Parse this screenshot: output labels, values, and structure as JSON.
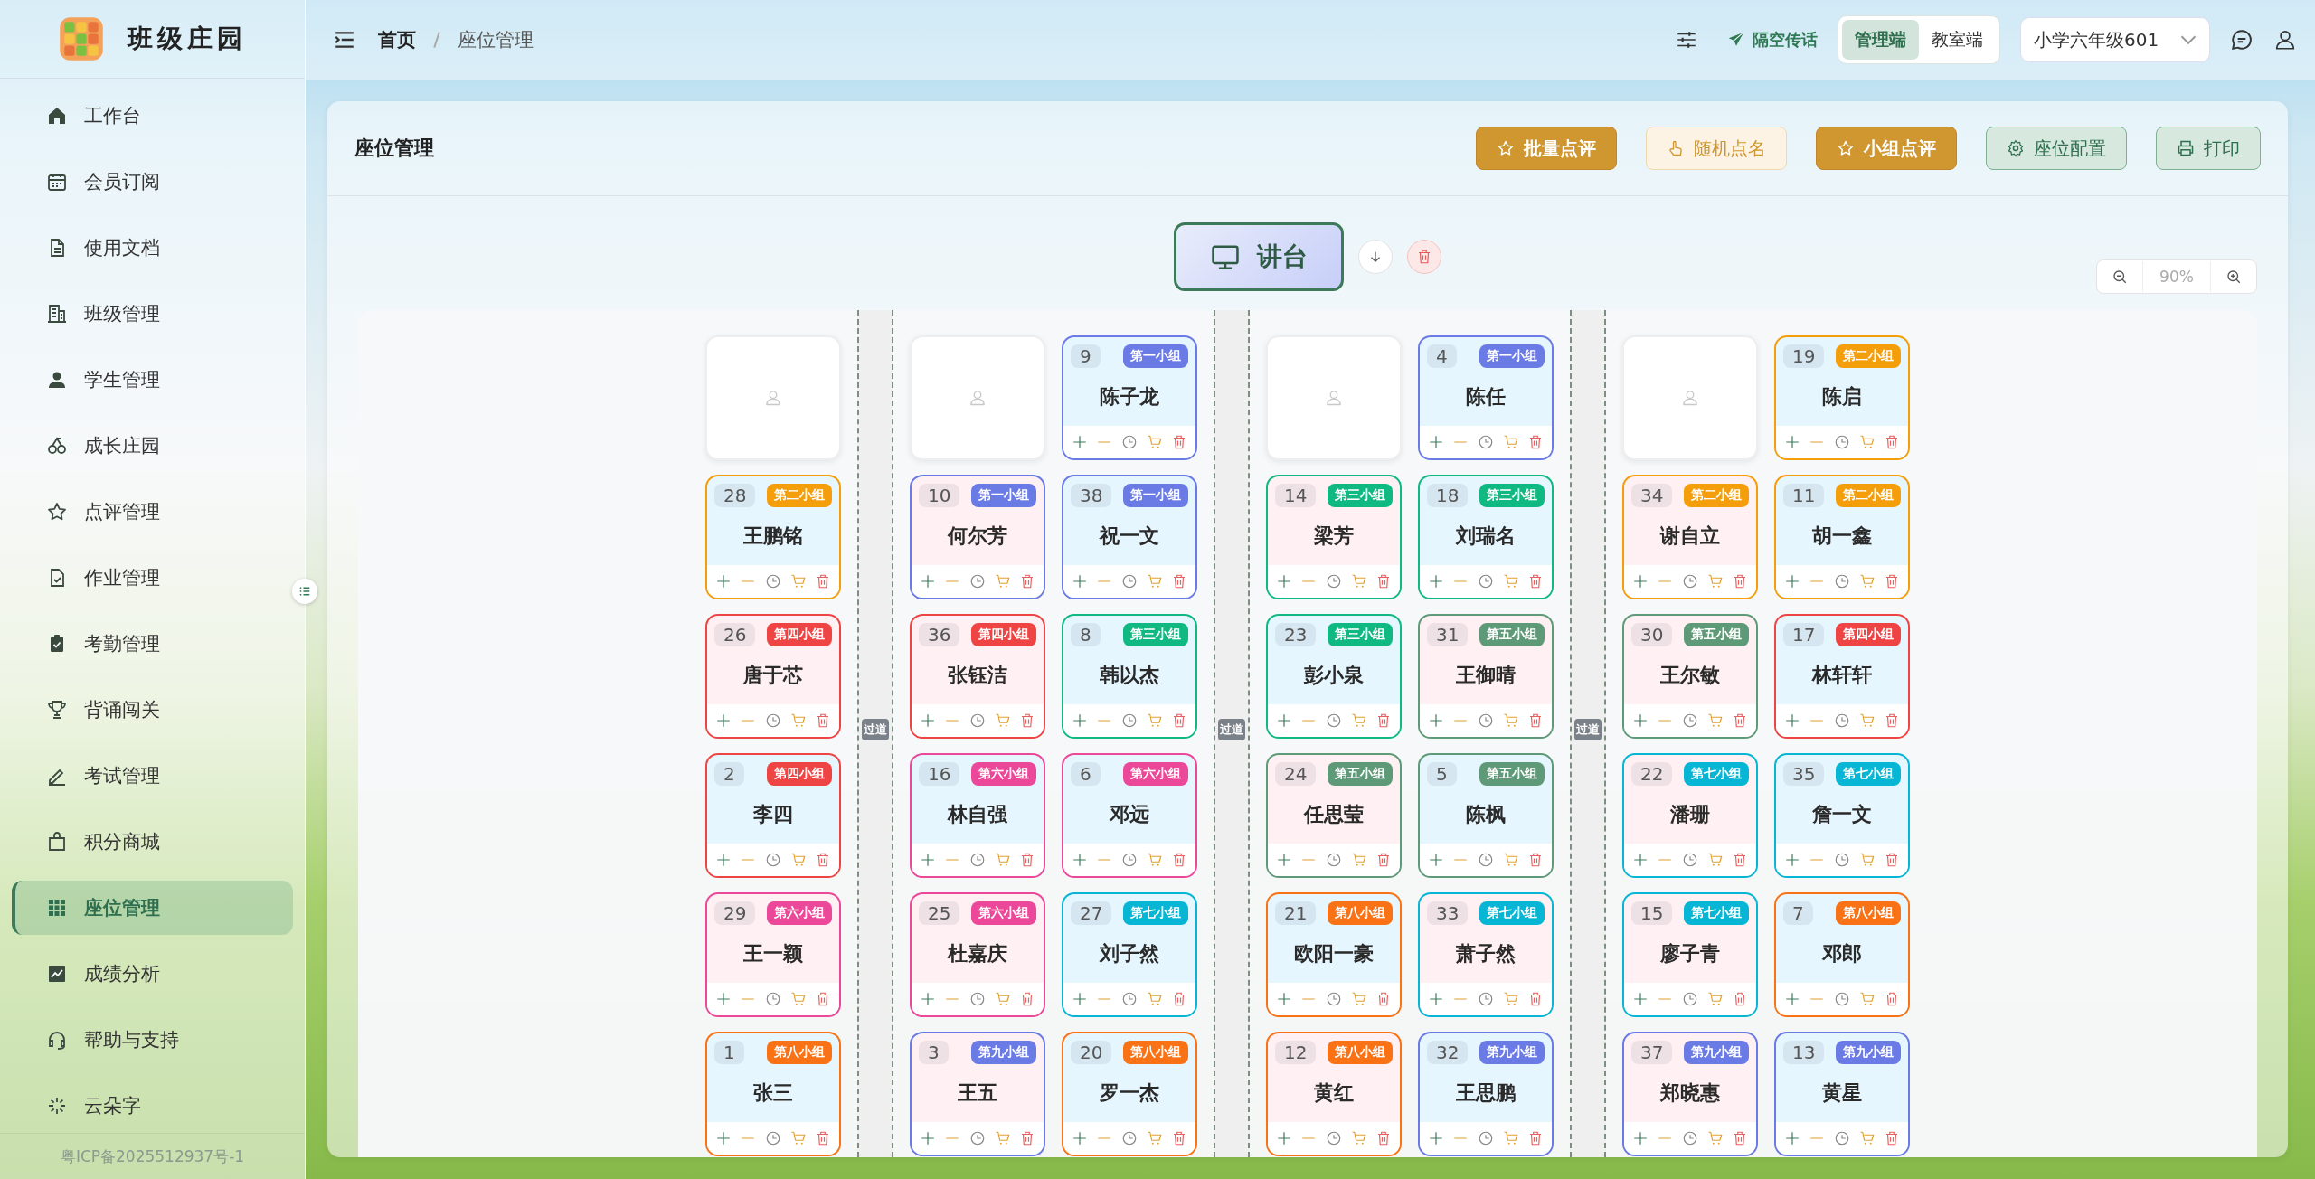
{
  "sidebar": {
    "title": "班级庄园",
    "items": [
      {
        "label": "工作台",
        "selected": false
      },
      {
        "label": "会员订阅",
        "selected": false
      },
      {
        "label": "使用文档",
        "selected": false
      },
      {
        "label": "班级管理",
        "selected": false
      },
      {
        "label": "学生管理",
        "selected": false
      },
      {
        "label": "成长庄园",
        "selected": false
      },
      {
        "label": "点评管理",
        "selected": false
      },
      {
        "label": "作业管理",
        "selected": false
      },
      {
        "label": "考勤管理",
        "selected": false
      },
      {
        "label": "背诵闯关",
        "selected": false
      },
      {
        "label": "考试管理",
        "selected": false
      },
      {
        "label": "积分商城",
        "selected": false
      },
      {
        "label": "座位管理",
        "selected": true
      },
      {
        "label": "成绩分析",
        "selected": false
      },
      {
        "label": "帮助与支持",
        "selected": false
      },
      {
        "label": "云朵字",
        "selected": false
      }
    ],
    "footer": "粤ICP备2025512937号-1"
  },
  "header": {
    "breadcrumb": [
      "首页",
      "座位管理"
    ],
    "broadcast": "隔空传话",
    "modes": [
      {
        "label": "管理端",
        "selected": true
      },
      {
        "label": "教室端",
        "selected": false
      }
    ],
    "class_select": {
      "value": "小学六年级601"
    }
  },
  "panel": {
    "title": "座位管理",
    "actions": [
      {
        "label": "批量点评",
        "kind": "primary"
      },
      {
        "label": "随机点名",
        "kind": "soft"
      },
      {
        "label": "小组点评",
        "kind": "primary"
      },
      {
        "label": "座位配置",
        "kind": "secondary"
      },
      {
        "label": "打印",
        "kind": "secondary"
      }
    ],
    "podium": {
      "label": "讲台"
    },
    "zoom": {
      "value": "90%"
    },
    "layout": [
      {
        "kind": "column",
        "seats": [
          {
            "kind": "empty"
          },
          {
            "kind": "student",
            "number": "28",
            "group": "第二小组",
            "name": "王鹏铭",
            "color": "#f59e0b",
            "warm": false
          },
          {
            "kind": "student",
            "number": "26",
            "group": "第四小组",
            "name": "唐于芯",
            "color": "#ef4444",
            "warm": true
          },
          {
            "kind": "student",
            "number": "2",
            "group": "第四小组",
            "name": "李四",
            "color": "#ef4444",
            "warm": false
          },
          {
            "kind": "student",
            "number": "29",
            "group": "第六小组",
            "name": "王一颖",
            "color": "#ec4899",
            "warm": true
          },
          {
            "kind": "student",
            "number": "1",
            "group": "第八小组",
            "name": "张三",
            "color": "#f97316",
            "warm": false
          }
        ]
      },
      {
        "kind": "aisle",
        "label": "过道"
      },
      {
        "kind": "column",
        "seats": [
          {
            "kind": "empty"
          },
          {
            "kind": "student",
            "number": "10",
            "group": "第一小组",
            "name": "何尔芳",
            "color": "#6b7be6",
            "warm": true
          },
          {
            "kind": "student",
            "number": "36",
            "group": "第四小组",
            "name": "张钰洁",
            "color": "#ef4444",
            "warm": true
          },
          {
            "kind": "student",
            "number": "16",
            "group": "第六小组",
            "name": "林自强",
            "color": "#ec4899",
            "warm": false
          },
          {
            "kind": "student",
            "number": "25",
            "group": "第六小组",
            "name": "杜嘉庆",
            "color": "#ec4899",
            "warm": true
          },
          {
            "kind": "student",
            "number": "3",
            "group": "第九小组",
            "name": "王五",
            "color": "#6b7be6",
            "warm": true
          }
        ]
      },
      {
        "kind": "column",
        "seats": [
          {
            "kind": "student",
            "number": "9",
            "group": "第一小组",
            "name": "陈子龙",
            "color": "#6b7be6",
            "warm": false
          },
          {
            "kind": "student",
            "number": "38",
            "group": "第一小组",
            "name": "祝一文",
            "color": "#6b7be6",
            "warm": false
          },
          {
            "kind": "student",
            "number": "8",
            "group": "第三小组",
            "name": "韩以杰",
            "color": "#10b981",
            "warm": false
          },
          {
            "kind": "student",
            "number": "6",
            "group": "第六小组",
            "name": "邓远",
            "color": "#ec4899",
            "warm": false
          },
          {
            "kind": "student",
            "number": "27",
            "group": "第七小组",
            "name": "刘子然",
            "color": "#06b6d4",
            "warm": false
          },
          {
            "kind": "student",
            "number": "20",
            "group": "第八小组",
            "name": "罗一杰",
            "color": "#f97316",
            "warm": false
          }
        ]
      },
      {
        "kind": "aisle",
        "label": "过道"
      },
      {
        "kind": "column",
        "seats": [
          {
            "kind": "empty"
          },
          {
            "kind": "student",
            "number": "14",
            "group": "第三小组",
            "name": "梁芳",
            "color": "#10b981",
            "warm": true
          },
          {
            "kind": "student",
            "number": "23",
            "group": "第三小组",
            "name": "彭小泉",
            "color": "#10b981",
            "warm": false
          },
          {
            "kind": "student",
            "number": "24",
            "group": "第五小组",
            "name": "任思莹",
            "color": "#5f9a78",
            "warm": true
          },
          {
            "kind": "student",
            "number": "21",
            "group": "第八小组",
            "name": "欧阳一豪",
            "color": "#f97316",
            "warm": false
          },
          {
            "kind": "student",
            "number": "12",
            "group": "第八小组",
            "name": "黄红",
            "color": "#f97316",
            "warm": true
          }
        ]
      },
      {
        "kind": "column",
        "seats": [
          {
            "kind": "student",
            "number": "4",
            "group": "第一小组",
            "name": "陈任",
            "color": "#6b7be6",
            "warm": false
          },
          {
            "kind": "student",
            "number": "18",
            "group": "第三小组",
            "name": "刘瑞名",
            "color": "#10b981",
            "warm": false
          },
          {
            "kind": "student",
            "number": "31",
            "group": "第五小组",
            "name": "王御晴",
            "color": "#5f9a78",
            "warm": true
          },
          {
            "kind": "student",
            "number": "5",
            "group": "第五小组",
            "name": "陈枫",
            "color": "#5f9a78",
            "warm": false
          },
          {
            "kind": "student",
            "number": "33",
            "group": "第七小组",
            "name": "萧子然",
            "color": "#06b6d4",
            "warm": true
          },
          {
            "kind": "student",
            "number": "32",
            "group": "第九小组",
            "name": "王思鹏",
            "color": "#6b7be6",
            "warm": false
          }
        ]
      },
      {
        "kind": "aisle",
        "label": "过道"
      },
      {
        "kind": "column",
        "seats": [
          {
            "kind": "empty"
          },
          {
            "kind": "student",
            "number": "34",
            "group": "第二小组",
            "name": "谢自立",
            "color": "#f59e0b",
            "warm": true
          },
          {
            "kind": "student",
            "number": "30",
            "group": "第五小组",
            "name": "王尔敏",
            "color": "#5f9a78",
            "warm": true
          },
          {
            "kind": "student",
            "number": "22",
            "group": "第七小组",
            "name": "潘珊",
            "color": "#06b6d4",
            "warm": true
          },
          {
            "kind": "student",
            "number": "15",
            "group": "第七小组",
            "name": "廖子青",
            "color": "#06b6d4",
            "warm": true
          },
          {
            "kind": "student",
            "number": "37",
            "group": "第九小组",
            "name": "郑晓惠",
            "color": "#6b7be6",
            "warm": true
          }
        ]
      },
      {
        "kind": "column",
        "seats": [
          {
            "kind": "student",
            "number": "19",
            "group": "第二小组",
            "name": "陈启",
            "color": "#f59e0b",
            "warm": false
          },
          {
            "kind": "student",
            "number": "11",
            "group": "第二小组",
            "name": "胡一鑫",
            "color": "#f59e0b",
            "warm": false
          },
          {
            "kind": "student",
            "number": "17",
            "group": "第四小组",
            "name": "林轩轩",
            "color": "#ef4444",
            "warm": false
          },
          {
            "kind": "student",
            "number": "35",
            "group": "第七小组",
            "name": "詹一文",
            "color": "#06b6d4",
            "warm": false
          },
          {
            "kind": "student",
            "number": "7",
            "group": "第八小组",
            "name": "邓郎",
            "color": "#f97316",
            "warm": false
          },
          {
            "kind": "student",
            "number": "13",
            "group": "第九小组",
            "name": "黄星",
            "color": "#6b7be6",
            "warm": false
          }
        ]
      }
    ]
  }
}
